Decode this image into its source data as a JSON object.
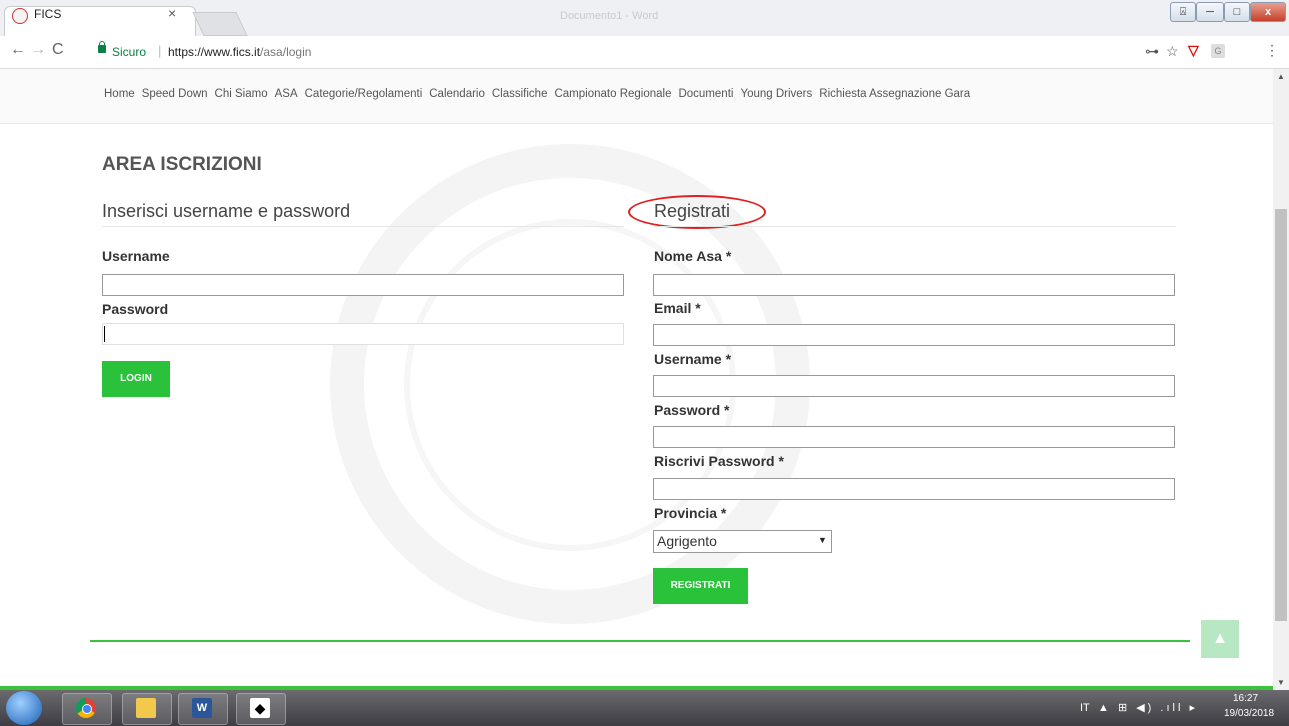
{
  "browser": {
    "tab_title": "FICS",
    "tab_close": "×",
    "secure_label": "Sicuro",
    "url_prefix": "https://",
    "url_host": "www.fics.it",
    "url_path": "/asa/login",
    "back": "←",
    "forward": "→",
    "reload": "C",
    "key_icon": "⊶",
    "star_icon": "☆",
    "shield_icon": "▽",
    "ext_icon": "G",
    "menu_icon": "⋮",
    "doc_title": "Documento1 - Word",
    "win_user": "⍓",
    "win_min": "─",
    "win_max": "□",
    "win_close": "x"
  },
  "menu": [
    "Home",
    "Speed Down",
    "Chi Siamo",
    "ASA",
    "Categorie/Regolamenti",
    "Calendario",
    "Classifiche",
    "Campionato Regionale",
    "Documenti",
    "Young Drivers",
    "Richiesta Assegnazione Gara"
  ],
  "page": {
    "area_title": "AREA ISCRIZIONI",
    "login": {
      "heading": "Inserisci username e password",
      "username_label": "Username",
      "password_label": "Password",
      "button": "LOGIN"
    },
    "register": {
      "heading": "Registrati",
      "nome_label": "Nome Asa *",
      "email_label": "Email *",
      "username_label": "Username *",
      "password_label": "Password *",
      "repeat_label": "Riscrivi Password *",
      "provincia_label": "Provincia *",
      "provincia_value": "Agrigento",
      "select_arrow": "▼",
      "button": "REGISTRATI"
    },
    "totop_icon": "▲"
  },
  "scrollbar": {
    "up": "▲",
    "down": "▼"
  },
  "taskbar": {
    "lang": "IT",
    "tray": "▲ ⊞ ◀) .ıll ▸",
    "time": "16:27",
    "date": "19/03/2018",
    "word_label": "W",
    "inkscape_label": "◆"
  },
  "colors": {
    "accent_green": "#2bc23b",
    "highlight_red": "#e02020",
    "secure_green": "#0b8043"
  }
}
